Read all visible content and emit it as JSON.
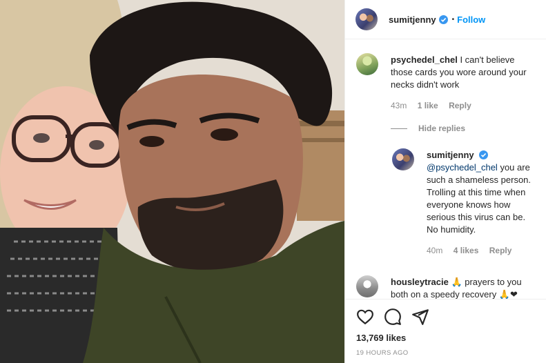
{
  "header": {
    "username": "sumitjenny",
    "dot": "•",
    "follow_label": "Follow"
  },
  "comments": [
    {
      "user": "psychedel_chel",
      "text": "I can't believe those cards you wore around your necks didn't work",
      "time": "43m",
      "likes": "1 like",
      "reply": "Reply"
    }
  ],
  "hide_replies_label": "Hide replies",
  "replies": [
    {
      "user": "sumitjenny",
      "mention": "@psychedel_chel",
      "text": " you are such a shameless person. Trolling at this time when everyone knows how serious this virus can be. No humidity.",
      "time": "40m",
      "likes": "4 likes",
      "reply": "Reply"
    }
  ],
  "partial_comment": {
    "user": "housleytracie",
    "text": "🙏 prayers to you both on a speedy recovery 🙏❤"
  },
  "actions": {
    "likes_count": "13,769 likes",
    "time_ago": "19 HOURS AGO"
  },
  "colors": {
    "accent": "#0095f6",
    "muted": "#8e8e8e",
    "mention": "#00376b",
    "verified": "#3897f0"
  }
}
